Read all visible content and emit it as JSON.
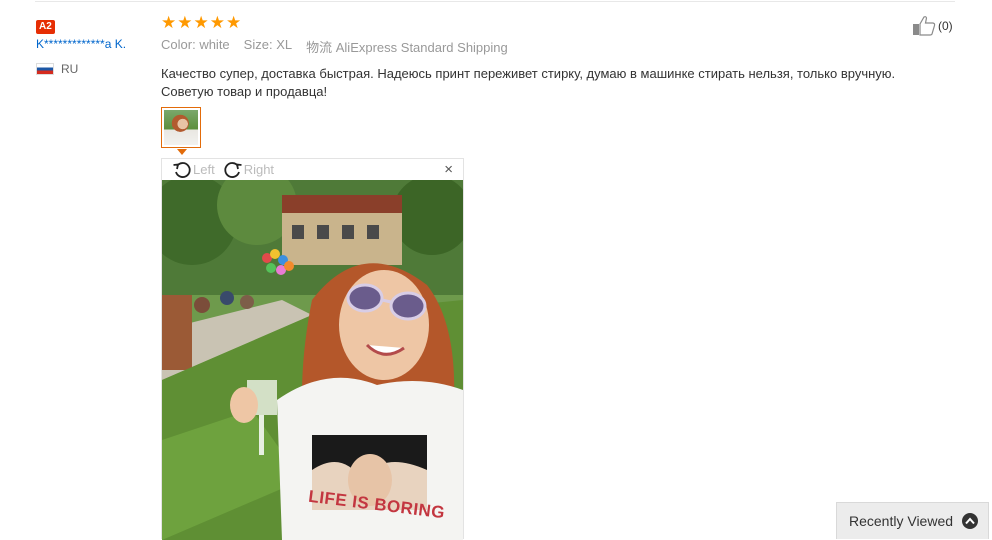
{
  "buyer": {
    "level_badge": "A2",
    "name": "K*************a K.",
    "country_code": "RU",
    "flag_icon": "russia-flag-icon"
  },
  "review": {
    "rating": 5,
    "star_icon": "star-icon",
    "color_label": "Color:",
    "color_value": "white",
    "size_label": "Size:",
    "size_value": "XL",
    "shipping_label": "物流",
    "shipping_value": "AliExpress Standard Shipping",
    "text": "Качество супер, доставка быстрая. Надеюсь принт переживет стирку, думаю в машинке стирать нельзя, только вручную. Советую товар и продавца!"
  },
  "helpful": {
    "icon": "thumbs-up-icon",
    "count": "(0)"
  },
  "viewer": {
    "rotate_left_label": "Left",
    "rotate_right_label": "Right",
    "close_label": "×",
    "shirt_print_text": "LIFE IS BORING"
  },
  "recently_viewed": {
    "label": "Recently Viewed",
    "icon": "chevron-up-icon"
  },
  "colors": {
    "link": "#0066cc",
    "star": "#ff9900",
    "badge": "#e62e04",
    "thumb_border": "#e26b0a"
  }
}
